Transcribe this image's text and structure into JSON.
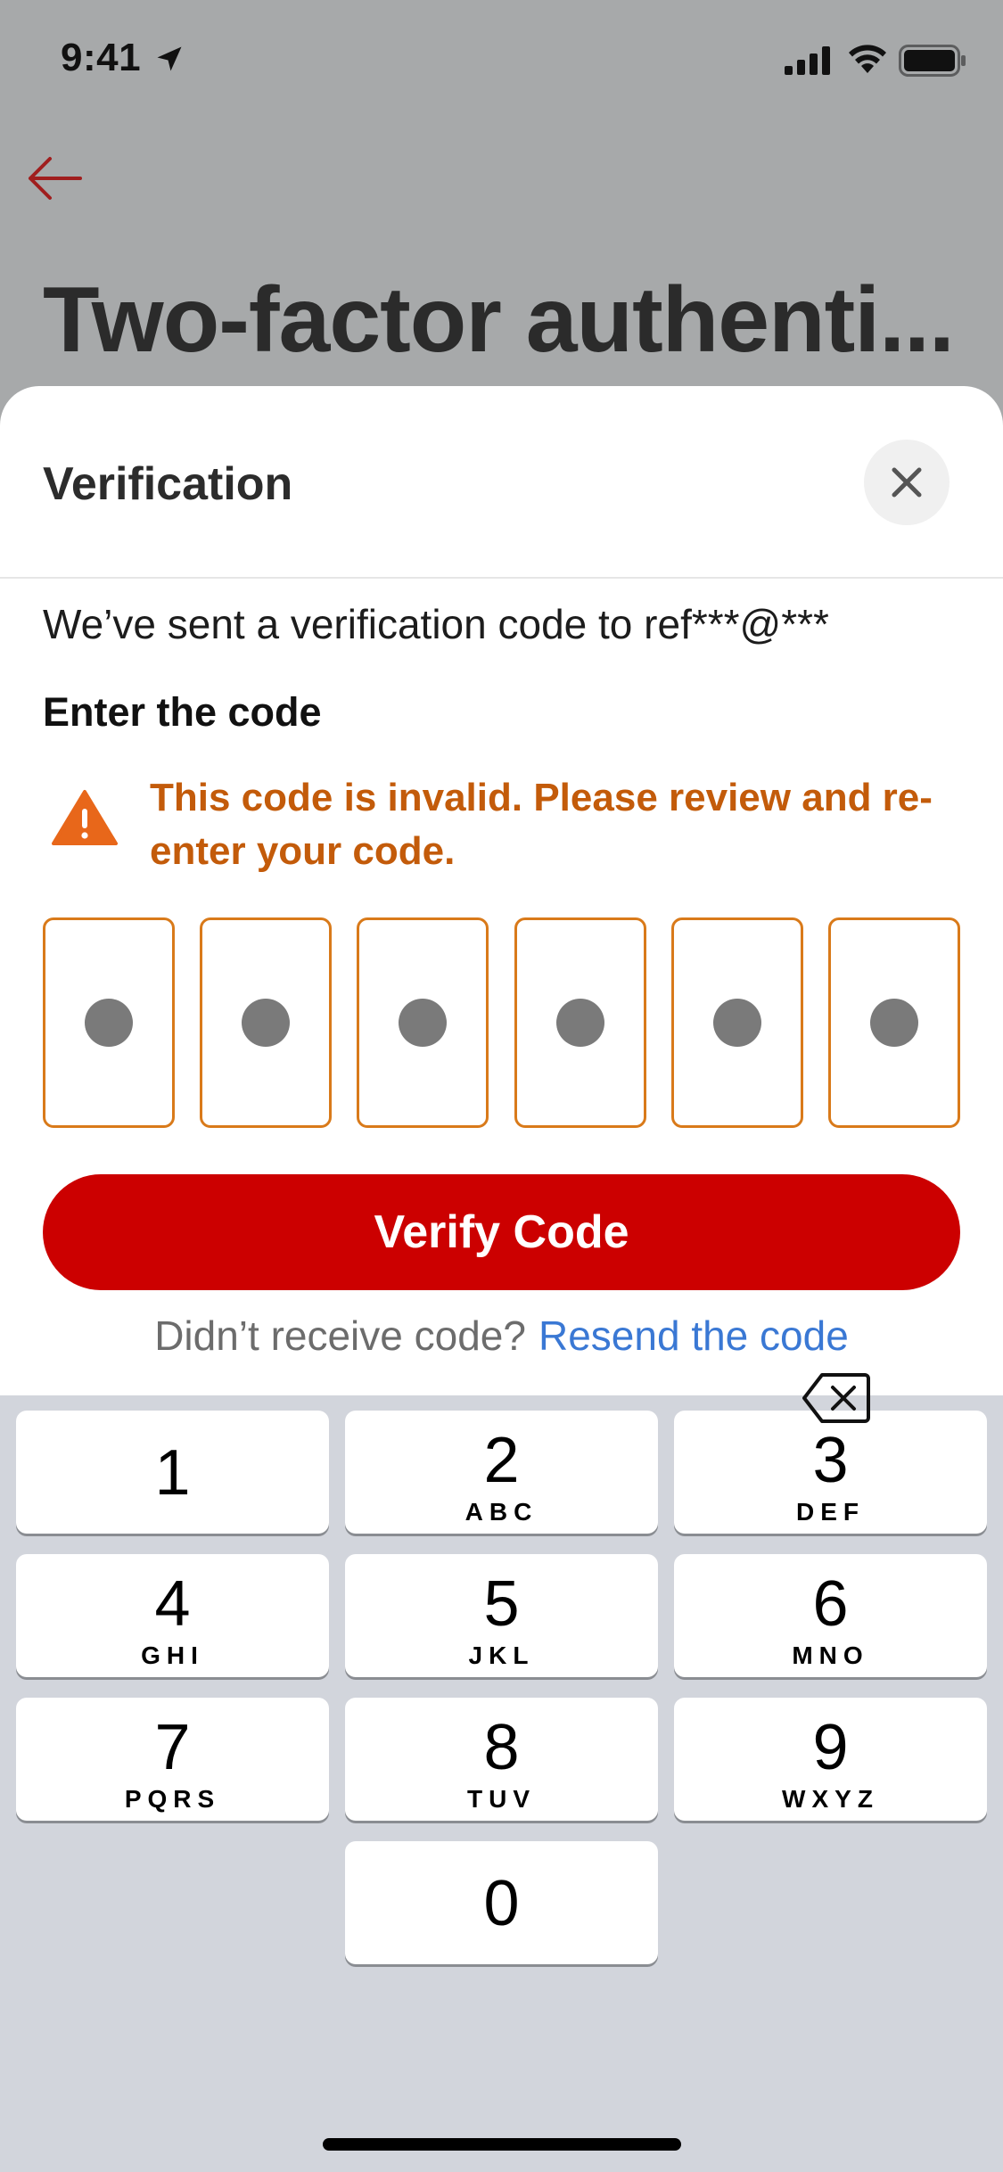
{
  "status_bar": {
    "time": "9:41"
  },
  "background": {
    "title": "Two-factor authenti..."
  },
  "sheet": {
    "title": "Verification",
    "sent_text": "We’ve sent a verification code to ref***@***",
    "enter_label": "Enter the code",
    "error_message": "This code is invalid. Please review and re-enter your code.",
    "code_digits": [
      "",
      "",
      "",
      "",
      "",
      ""
    ],
    "verify_label": "Verify Code",
    "resend_question": "Didn’t receive code?",
    "resend_link": "Resend the code"
  },
  "colors": {
    "brand_red": "#cc0000",
    "error_orange": "#c35b0a",
    "link_blue": "#3a78d4"
  },
  "keyboard": {
    "keys": [
      {
        "num": "1",
        "letters": ""
      },
      {
        "num": "2",
        "letters": "ABC"
      },
      {
        "num": "3",
        "letters": "DEF"
      },
      {
        "num": "4",
        "letters": "GHI"
      },
      {
        "num": "5",
        "letters": "JKL"
      },
      {
        "num": "6",
        "letters": "MNO"
      },
      {
        "num": "7",
        "letters": "PQRS"
      },
      {
        "num": "8",
        "letters": "TUV"
      },
      {
        "num": "9",
        "letters": "WXYZ"
      },
      {
        "num": "0",
        "letters": ""
      }
    ]
  }
}
